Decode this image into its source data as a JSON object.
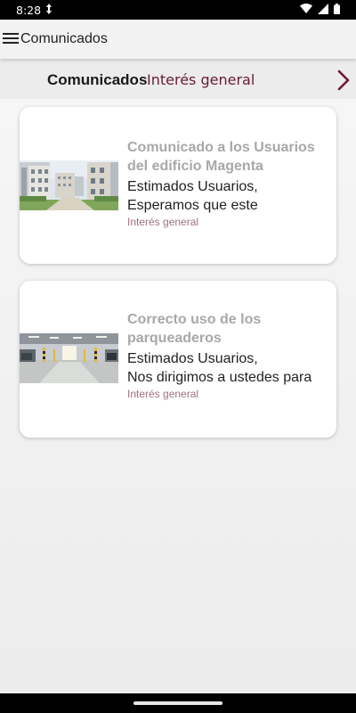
{
  "status": {
    "time": "8:28"
  },
  "app_bar": {
    "title": "Comunicados"
  },
  "tabs": [
    {
      "label": "Comunicados",
      "selected": true
    },
    {
      "label": "Interés general",
      "selected": false
    }
  ],
  "colors": {
    "accent": "#6a1a3a",
    "card_title": "#a8a8a8",
    "category": "#a07080"
  },
  "cards": [
    {
      "title": "Comunicado a los Usuarios del edificio Magenta",
      "body": "Estimados Usuarios,\nEsperamos que este",
      "category": "Interés general",
      "image": "apartment-buildings-photo"
    },
    {
      "title": "Correcto uso de los parqueaderos",
      "body": "Estimados Usuarios,\nNos dirigimos a ustedes para",
      "category": "Interés general",
      "image": "parking-garage-photo"
    }
  ]
}
